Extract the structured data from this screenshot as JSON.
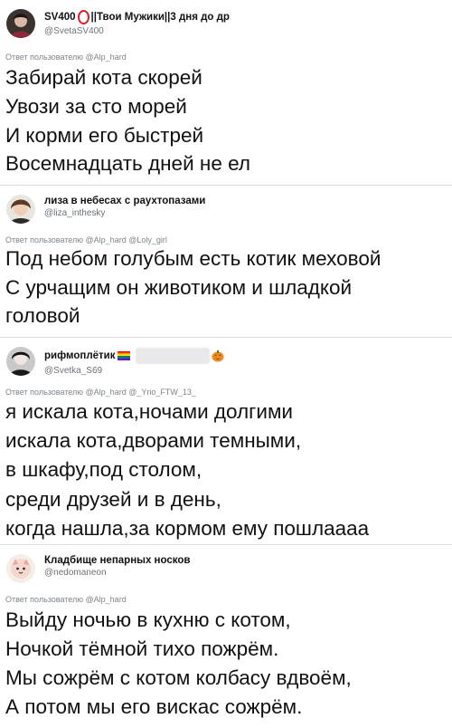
{
  "tweets": [
    {
      "name": "SV400",
      "name_suffix": "||Твои Мужики||3 дня до др",
      "handle": "@SvetaSV400",
      "reply_prefix": "Ответ пользователю",
      "reply_mentions": "@Alp_hard",
      "lines": [
        "Забирай кота скорей",
        "Увози за сто морей",
        "И корми его быстрей",
        "Восемнадцать дней не ел"
      ]
    },
    {
      "name": "лиза в небесах с раухтопазами",
      "handle": "@liza_inthesky",
      "reply_prefix": "Ответ пользователю",
      "reply_mentions": "@Alp_hard @Loly_girl",
      "lines": [
        "Под небом голубым есть котик меховой",
        "С урчащим он животиком и шладкой",
        "головой"
      ]
    },
    {
      "name": "рифмоплётик",
      "handle": "@Svetka_S69",
      "reply_prefix": "Ответ пользователю",
      "reply_mentions": "@Alp_hard @_Yrio_FTW_13_",
      "lines": [
        "я искала кота,ночами долгими",
        "искала кота,дворами темными,",
        "в шкафу,под столом,",
        "среди друзей и в день,",
        "когда нашла,за кормом ему пошлаааа"
      ]
    },
    {
      "name": "Кладбище непарных носков",
      "handle": "@nedomaneon",
      "reply_prefix": "Ответ пользователю",
      "reply_mentions": "@Alp_hard",
      "lines": [
        "Выйду ночью в кухню с котом,",
        "Ночкой тёмной тихо пожрём.",
        "Мы сожрём с котом колбасу вдвоём,",
        "А потом мы его вискас сожрём."
      ]
    }
  ],
  "icons": {
    "avatar1": "avatar-icon",
    "avatar2": "avatar-icon",
    "avatar3": "avatar-icon",
    "avatar4": "avatar-icon"
  },
  "colors": {
    "text": "#111111",
    "muted": "#7d848b",
    "divider": "#dcdcdc",
    "ring": "#d6202a"
  }
}
